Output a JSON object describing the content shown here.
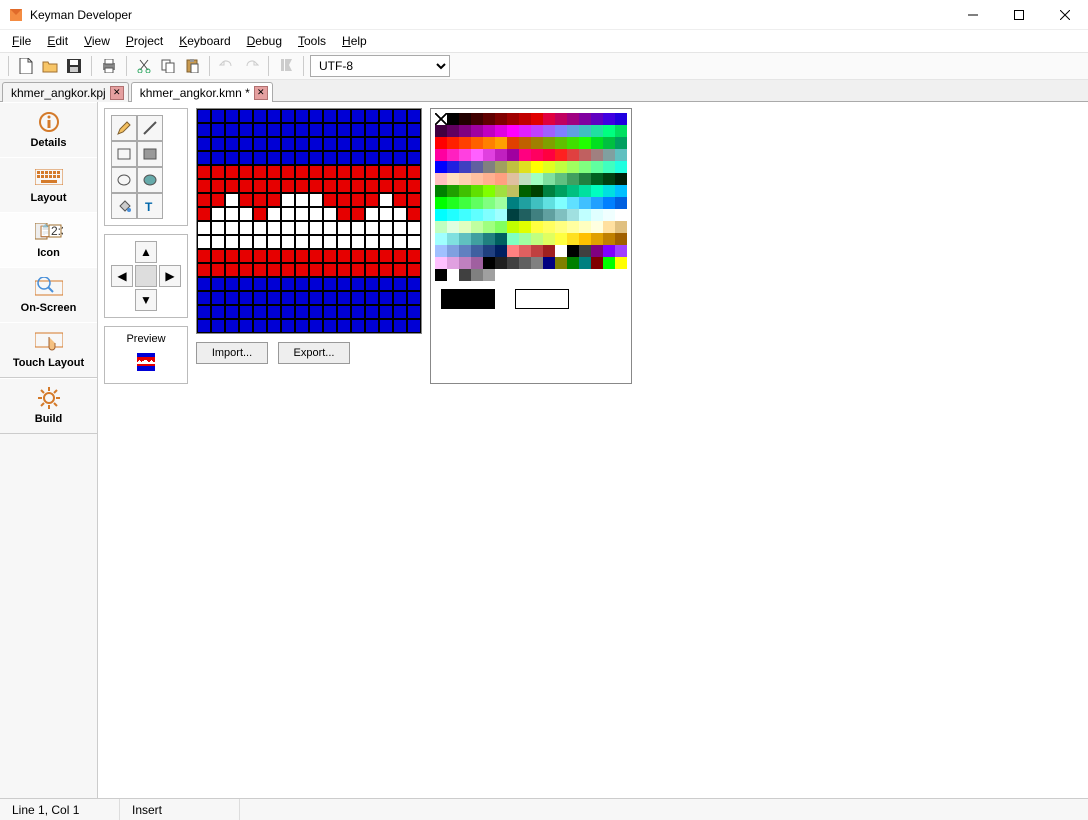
{
  "app": {
    "title": "Keyman Developer"
  },
  "menu": {
    "file": "File",
    "edit": "Edit",
    "view": "View",
    "project": "Project",
    "keyboard": "Keyboard",
    "debug": "Debug",
    "tools": "Tools",
    "help": "Help"
  },
  "toolbar": {
    "encoding_selected": "UTF-8",
    "encoding_options": [
      "UTF-8"
    ]
  },
  "tabs": [
    {
      "label": "khmer_angkor.kpj",
      "active": false
    },
    {
      "label": "khmer_angkor.kmn *",
      "active": true
    }
  ],
  "leftnav": {
    "details": "Details",
    "layout": "Layout",
    "icon": "Icon",
    "onscreen": "On-Screen",
    "touchlayout": "Touch Layout",
    "build": "Build"
  },
  "editor": {
    "preview_label": "Preview",
    "import_btn": "Import...",
    "export_btn": "Export...",
    "fg_color": "#000000",
    "bg_color": "#ffffff",
    "pixel_grid": [
      "BBBBBBBBBBBBBBBB",
      "BBBBBBBBBBBBBBBB",
      "BBBBBBBBBBBBBBBB",
      "BBBBBBBBBBBBBBBB",
      "RRRRRRRRRRRRRRRR",
      "RRRRRRRRRRRRRRRR",
      "RRWRRRWWWRRRRWRR",
      "RWWWRWWWWWRRWWWR",
      "WWWWWWWWWWWWWWWW",
      "WWWWWWWWWWWWWWWW",
      "RRRRRRRRRRRRRRRR",
      "RRRRRRRRRRRRRRRR",
      "BBBBBBBBBBBBBBBB",
      "BBBBBBBBBBBBBBBB",
      "BBBBBBBBBBBBBBBB",
      "BBBBBBBBBBBBBBBB"
    ],
    "pixel_colors": {
      "B": "#0000D6",
      "R": "#E60000",
      "W": "#FFFFFF"
    },
    "palette": [
      [
        "X",
        "#000000",
        "#200000",
        "#400000",
        "#600000",
        "#800000",
        "#A00000",
        "#C00000",
        "#E00000",
        "#E00040",
        "#C00060",
        "#A00080",
        "#8000A0",
        "#6000C0",
        "#4000E0",
        "#2000E0"
      ],
      [
        "#400040",
        "#600060",
        "#800080",
        "#A000A0",
        "#C000C0",
        "#E000E0",
        "#FF00FF",
        "#E020FF",
        "#C040FF",
        "#A060FF",
        "#8080FF",
        "#60A0E0",
        "#40C0C0",
        "#20E0A0",
        "#00FF80",
        "#00E060"
      ],
      [
        "#FF0000",
        "#FF2000",
        "#FF4000",
        "#FF6000",
        "#FF8000",
        "#FFA000",
        "#E04000",
        "#C06000",
        "#A08000",
        "#80A000",
        "#60C000",
        "#40E000",
        "#20FF00",
        "#00E020",
        "#00C040",
        "#00A060"
      ],
      [
        "#FF00A0",
        "#FF20C0",
        "#FF40E0",
        "#FF60FF",
        "#E040E0",
        "#C020C0",
        "#A000A0",
        "#FF0080",
        "#FF0060",
        "#FF0040",
        "#FF2020",
        "#E04040",
        "#C06060",
        "#A08080",
        "#80A0A0",
        "#60C0C0"
      ],
      [
        "#0000FF",
        "#2020E0",
        "#4040C0",
        "#6060A0",
        "#808080",
        "#A0A060",
        "#C0C040",
        "#E0E020",
        "#FFFF00",
        "#E0FF20",
        "#C0FF40",
        "#A0FF60",
        "#80FF80",
        "#60FFA0",
        "#40FFC0",
        "#20FFE0"
      ],
      [
        "#FFC0C0",
        "#FFE0C0",
        "#FFD0B0",
        "#FFC0A0",
        "#FFB090",
        "#FFA080",
        "#E0C0A0",
        "#C0E0C0",
        "#A0FFC0",
        "#80E0A0",
        "#60C080",
        "#40A060",
        "#208040",
        "#006020",
        "#004010",
        "#002008"
      ],
      [
        "#008000",
        "#20A000",
        "#40C000",
        "#60E000",
        "#80FF00",
        "#A0E040",
        "#C0C060",
        "#006000",
        "#004000",
        "#008040",
        "#00A060",
        "#00C080",
        "#00E0A0",
        "#00FFC0",
        "#00E0E0",
        "#00C0FF"
      ],
      [
        "#00FF00",
        "#20FF20",
        "#40FF40",
        "#60FF60",
        "#80FF80",
        "#A0FFA0",
        "#008080",
        "#20A0A0",
        "#40C0C0",
        "#60E0E0",
        "#80FFFF",
        "#60E0FF",
        "#40C0FF",
        "#20A0FF",
        "#0080FF",
        "#0060E0"
      ],
      [
        "#00FFFF",
        "#20FFFF",
        "#40FFFF",
        "#60FFFF",
        "#80FFFF",
        "#A0FFFF",
        "#004040",
        "#206060",
        "#408080",
        "#60A0A0",
        "#80C0C0",
        "#A0E0E0",
        "#C0FFFF",
        "#E0FFFF",
        "#F0FFFF",
        "#FFFFFF"
      ],
      [
        "#C0FFC0",
        "#E0FFE0",
        "#E0FFC0",
        "#C0FFA0",
        "#A0FF80",
        "#80FF60",
        "#C0FF00",
        "#E0FF00",
        "#FFFF40",
        "#FFFF60",
        "#FFFF80",
        "#FFFFA0",
        "#FFFFC0",
        "#FFFFE0",
        "#FFE0A0",
        "#E0C080"
      ],
      [
        "#A0FFFF",
        "#80E0E0",
        "#60C0C0",
        "#40A0A0",
        "#208080",
        "#006060",
        "#80FFC0",
        "#A0FFA0",
        "#C0FF80",
        "#E0FF60",
        "#FFFF40",
        "#FFE020",
        "#FFC000",
        "#E0A000",
        "#C08000",
        "#A06000"
      ],
      [
        "#A0C0FF",
        "#80A0E0",
        "#6080C0",
        "#4060A0",
        "#204080",
        "#002060",
        "#FF8080",
        "#E06060",
        "#C04040",
        "#A02020",
        "#FFFFFF",
        "#000000",
        "#404040",
        "#800080",
        "#8000FF",
        "#A040FF"
      ],
      [
        "#FFC0FF",
        "#E0A0E0",
        "#C080C0",
        "#A060A0",
        "#000000",
        "#202020",
        "#404040",
        "#606060",
        "#808080",
        "#000080",
        "#808000",
        "#008000",
        "#008080",
        "#800000",
        "#00FF00",
        "#FFFF00"
      ],
      [
        "#000000",
        "#FFFFFF",
        "#404040",
        "#808080",
        "#A0A0A0"
      ]
    ]
  },
  "statusbar": {
    "position": "Line 1, Col 1",
    "mode": "Insert"
  }
}
